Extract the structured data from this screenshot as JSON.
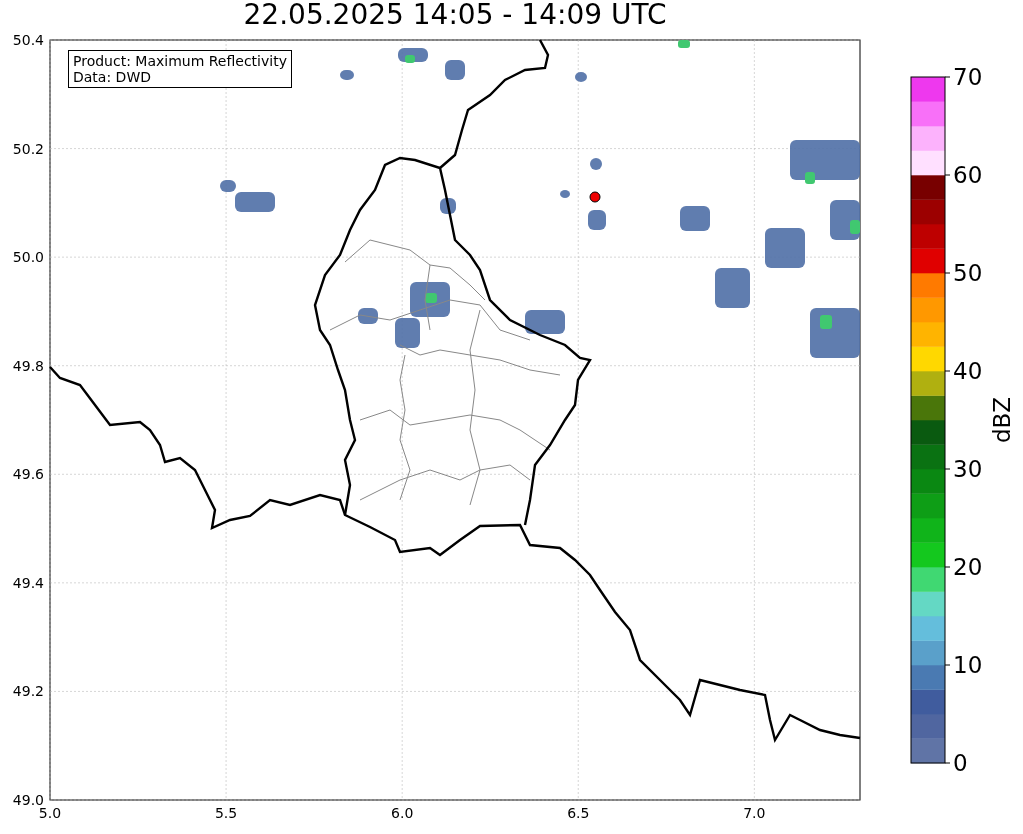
{
  "title": "22.05.2025 14:05 - 14:09 UTC",
  "legend": [
    "Product: Maximum Reflectivity",
    "Data: DWD"
  ],
  "map": {
    "xticks": [
      "5.0",
      "5.5",
      "6.0",
      "6.5",
      "7.0"
    ],
    "yticks": [
      "50.4",
      "50.2",
      "50.0",
      "49.8",
      "49.6",
      "49.4",
      "49.2",
      "49.0"
    ]
  },
  "colorbar": {
    "label": "dBZ",
    "ticks": [
      "70",
      "60",
      "50",
      "40",
      "30",
      "20",
      "10",
      "0"
    ],
    "bins": [
      {
        "color": "#6074a6"
      },
      {
        "color": "#5066a0"
      },
      {
        "color": "#405c9e"
      },
      {
        "color": "#4a7ab2"
      },
      {
        "color": "#5aa0ca"
      },
      {
        "color": "#64bedc"
      },
      {
        "color": "#64d8c4"
      },
      {
        "color": "#40d872"
      },
      {
        "color": "#14c81e"
      },
      {
        "color": "#10b41a"
      },
      {
        "color": "#0e9e16"
      },
      {
        "color": "#0a8812"
      },
      {
        "color": "#0a7212"
      },
      {
        "color": "#0a5a10"
      },
      {
        "color": "#4a760a"
      },
      {
        "color": "#b0b010"
      },
      {
        "color": "#ffd800"
      },
      {
        "color": "#ffb400"
      },
      {
        "color": "#ff9800"
      },
      {
        "color": "#ff7a00"
      },
      {
        "color": "#e00000"
      },
      {
        "color": "#be0000"
      },
      {
        "color": "#9c0000"
      },
      {
        "color": "#780000"
      },
      {
        "color": "#ffe0ff"
      },
      {
        "color": "#fcb2fc"
      },
      {
        "color": "#f870f8"
      },
      {
        "color": "#ee38ee"
      }
    ]
  }
}
